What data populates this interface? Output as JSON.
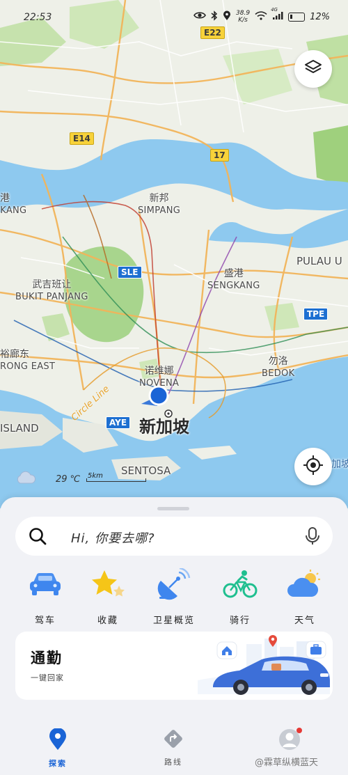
{
  "status_bar": {
    "time": "22:53",
    "net_speed_value": "38.9",
    "net_speed_unit": "K/s",
    "cell_label": "4G",
    "battery_percent": "12%"
  },
  "map": {
    "labels": {
      "xinbang_zh": "新邦",
      "xinbang_en": "SIMPANG",
      "kang_zh": "蔡厝港",
      "kang_en": "U KANG",
      "bukit_zh": "武吉班让",
      "bukit_en": "BUKIT PANJANG",
      "sengkang_zh": "盛港",
      "sengkang_en": "SENGKANG",
      "pulau": "PULAU U",
      "yulang_zh": "裕廊东",
      "yulang_en": "RONG EAST",
      "island": "ISLAND",
      "novena_zh": "诺维娜",
      "novena_en": "NOVENA",
      "bedok_zh": "勿洛",
      "bedok_en": "BEDOK",
      "singapore_zh": "新加坡",
      "sentosa": "SENTOSA",
      "right_edge": "加坡",
      "circle_line": "Circle Line"
    },
    "road_shields": {
      "e22": "E22",
      "e14": "E14",
      "r17": "17",
      "sle": "SLE",
      "tpe": "TPE",
      "aye": "AYE"
    },
    "weather_temp": "29 ℃",
    "scale_label": "5km"
  },
  "search": {
    "placeholder": "Hi, 你要去哪?"
  },
  "quick_actions": [
    {
      "label": "驾车",
      "icon": "car-icon"
    },
    {
      "label": "收藏",
      "icon": "star-icon"
    },
    {
      "label": "卫星概览",
      "icon": "satellite-icon"
    },
    {
      "label": "骑行",
      "icon": "bike-icon"
    },
    {
      "label": "天气",
      "icon": "weather-icon"
    }
  ],
  "commute": {
    "title": "通勤",
    "subtitle": "一键回家"
  },
  "bottom_nav": [
    {
      "label": "探索",
      "icon": "location-pin-icon",
      "active": true
    },
    {
      "label": "路线",
      "icon": "route-icon",
      "active": false
    },
    {
      "label": "",
      "icon": "avatar-icon",
      "active": false
    }
  ],
  "watermark": "@霖草纵横蓝天",
  "colors": {
    "accent": "#1a64d6",
    "water": "#8ec9ef",
    "land": "#eef0e8",
    "park": "#bcdca0",
    "card": "#ffffff",
    "sheet": "#f1f2f6"
  }
}
